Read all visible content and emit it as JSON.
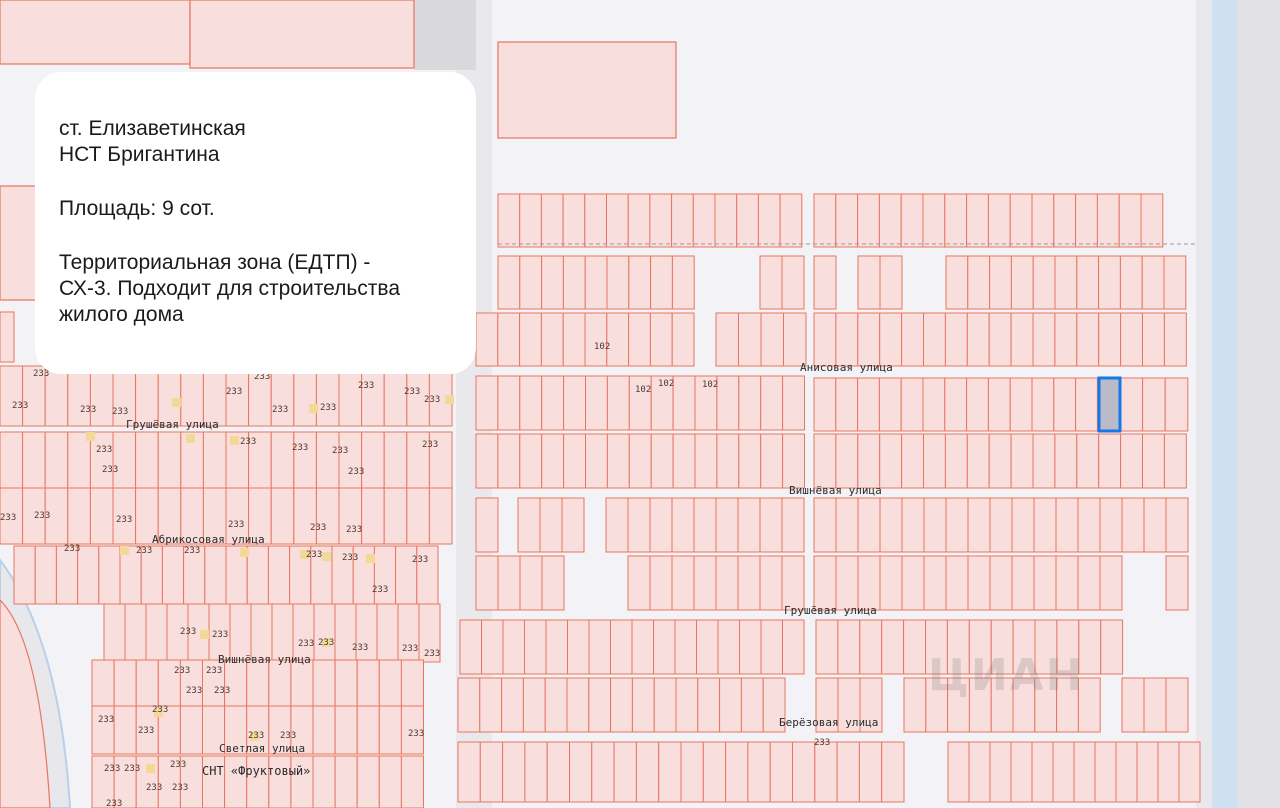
{
  "info_card": {
    "location_line1": "ст. Елизаветинская",
    "location_line2": "НСТ Бригантина",
    "area": "Площадь: 9 сот.",
    "zone_line1": "Территориальная зона (ЕДТП) -",
    "zone_line2": "СХ-3. Подходит для строительства",
    "zone_line3": "жилого дома"
  },
  "streets": {
    "anisovaya": "Анисовая улица",
    "vishnevaya_right": "Вишнёвая улица",
    "grushevaya_right": "Грушёвая улица",
    "berezovaya": "Берёзовая улица",
    "grushevaya_left": "Грушёвая улица",
    "abrikosovaya": "Абрикосовая улица",
    "vishnevaya_left": "Вишнёвая улица",
    "svetlaya": "Светлая улица"
  },
  "places": {
    "snt": "СНТ «Фруктовый»"
  },
  "parcel_numbers": {
    "n102": "102",
    "n233": "233"
  },
  "watermark": "ЦИАН",
  "colors": {
    "background": "#f3f2f6",
    "parcel_fill": "#f9dede",
    "parcel_stroke": "#e8765e",
    "highlight_fill": "#b9bcc8",
    "highlight_stroke": "#1677e6",
    "road": "#e6e5ea",
    "water": "#cfe0f0"
  }
}
